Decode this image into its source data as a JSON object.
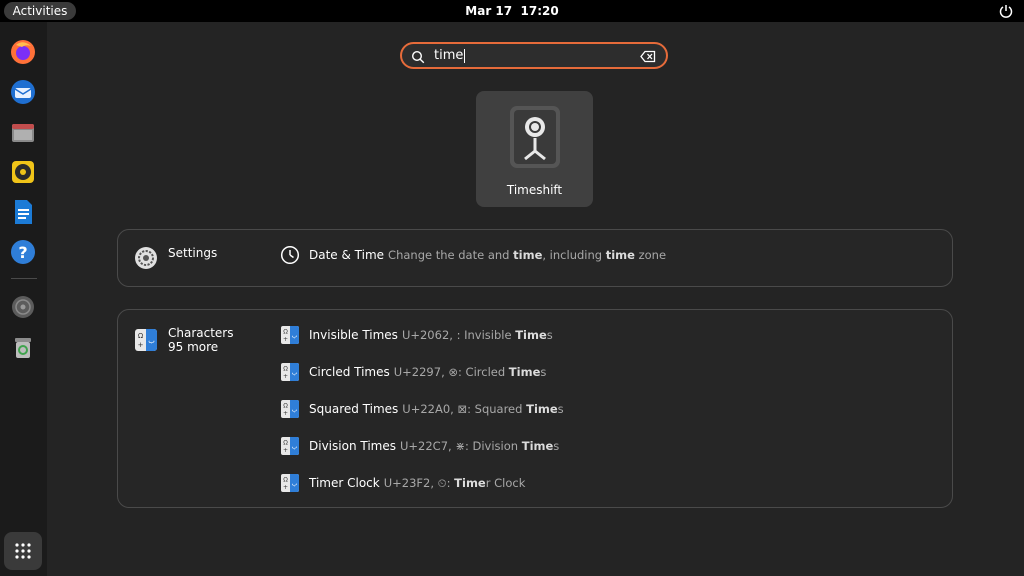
{
  "topbar": {
    "activities": "Activities",
    "date": "Mar 17",
    "time": "17:20"
  },
  "dock": {
    "items": [
      "firefox-icon",
      "thunderbird-icon",
      "files-icon",
      "rhythmbox-icon",
      "writer-icon",
      "help-icon",
      "disc-icon",
      "trash-icon"
    ],
    "apps_button": "show-apps-icon"
  },
  "search": {
    "query": "time"
  },
  "app_result": {
    "label": "Timeshift"
  },
  "settings_section": {
    "provider": "Settings",
    "result": {
      "title": "Date & Time",
      "desc_parts": [
        "Change the date and ",
        "time",
        ", including ",
        "time",
        " zone"
      ]
    }
  },
  "characters_section": {
    "provider": "Characters",
    "more": "95 more",
    "results": [
      {
        "title": "Invisible Times",
        "desc_pre": "U+2062, : Invisible ",
        "desc_bold": "Time",
        "desc_post": "s"
      },
      {
        "title": "Circled Times",
        "desc_pre": "U+2297, ⊗: Circled ",
        "desc_bold": "Time",
        "desc_post": "s"
      },
      {
        "title": "Squared Times",
        "desc_pre": "U+22A0, ⊠: Squared ",
        "desc_bold": "Time",
        "desc_post": "s"
      },
      {
        "title": "Division Times",
        "desc_pre": "U+22C7, ⋇: Division ",
        "desc_bold": "Time",
        "desc_post": "s"
      },
      {
        "title": "Timer Clock",
        "desc_pre": "U+23F2, ⏲: ",
        "desc_bold": "Time",
        "desc_post": "r Clock"
      }
    ]
  },
  "colors": {
    "accent": "#e66b3a",
    "background": "#242424",
    "dock": "#1b1b1b"
  }
}
